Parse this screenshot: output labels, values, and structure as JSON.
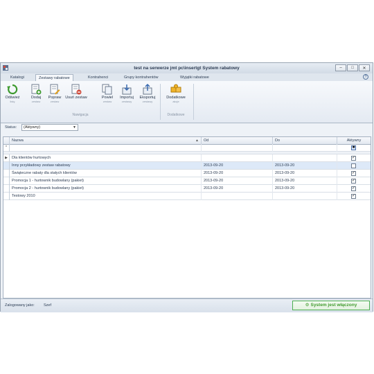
{
  "window": {
    "title": "test na serwerze jmt pc\\insertgt  System rabatowy",
    "controls": {
      "minimize": "–",
      "maximize": "□",
      "close": "✕"
    }
  },
  "tabs": [
    {
      "label": "Katalogi",
      "active": false
    },
    {
      "label": "Zestawy rabatowe",
      "active": true
    },
    {
      "label": "Kontrahenci",
      "active": false
    },
    {
      "label": "Grupy kontrahentów",
      "active": false
    },
    {
      "label": "Wyjątki rabatowe",
      "active": false
    }
  ],
  "ribbon": {
    "groups": [
      {
        "label": "Nawigacja",
        "buttons": [
          {
            "label": "Odśwież",
            "sub": "listę",
            "icon": "refresh-icon"
          },
          {
            "label": "Dodaj",
            "sub": "zestaw",
            "icon": "add-document-icon"
          },
          {
            "label": "Popraw",
            "sub": "zestaw",
            "icon": "edit-document-icon"
          },
          {
            "label": "Usuń zestaw",
            "sub": "",
            "icon": "delete-document-icon"
          },
          {
            "label": "Powiel",
            "sub": "zestaw",
            "icon": "copy-icon"
          },
          {
            "label": "Importuj",
            "sub": "zestawy",
            "icon": "import-icon"
          },
          {
            "label": "Eksportuj",
            "sub": "zestawy",
            "icon": "export-icon"
          }
        ]
      },
      {
        "label": "Dodatkowe",
        "buttons": [
          {
            "label": "Dodatkowe",
            "sub": "akcje",
            "icon": "puzzle-icon"
          }
        ]
      }
    ]
  },
  "filter": {
    "label": "Status:",
    "value": "(Aktywny)"
  },
  "grid": {
    "columns": {
      "name": "Nazwa",
      "from": "Od",
      "to": "Do",
      "active": "Aktywny"
    },
    "rows": [
      {
        "name": "Dla klientów hurtowych",
        "from": "",
        "to": "",
        "active": true,
        "pointer": true,
        "selected": false
      },
      {
        "name": "Inny przykładowy zestaw rabatowy",
        "from": "2013-09-20",
        "to": "2013-09-20",
        "active": false,
        "pointer": false,
        "selected": true
      },
      {
        "name": "Świąteczne rabaty dla stałych klientów",
        "from": "2013-09-20",
        "to": "2013-09-20",
        "active": true,
        "pointer": false,
        "selected": false
      },
      {
        "name": "Promocja 1 - hurtownik budowlany (pakiet)",
        "from": "2013-09-20",
        "to": "2013-09-20",
        "active": true,
        "pointer": false,
        "selected": false
      },
      {
        "name": "Promocja 2 - hurtownik budowlany (pakiet)",
        "from": "2013-09-20",
        "to": "2013-09-20",
        "active": true,
        "pointer": false,
        "selected": false
      },
      {
        "name": "Testowy 2010",
        "from": "",
        "to": "",
        "active": true,
        "pointer": false,
        "selected": false
      }
    ]
  },
  "statusbar": {
    "user_label": "Zalogowany jako:",
    "user_value": "Szef",
    "system_status": "System jest włączony"
  }
}
